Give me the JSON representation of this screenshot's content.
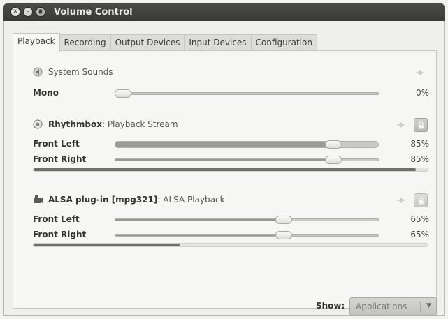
{
  "window": {
    "title": "Volume Control"
  },
  "tabs": [
    "Playback",
    "Recording",
    "Output Devices",
    "Input Devices",
    "Configuration"
  ],
  "streams": [
    {
      "app": "System Sounds",
      "desc": "",
      "channels": [
        {
          "label": "Mono",
          "value": 0,
          "display": "0%"
        }
      ],
      "level": null
    },
    {
      "app": "Rhythmbox",
      "desc": ": Playback Stream",
      "channels": [
        {
          "label": "Front Left",
          "value": 85,
          "display": "85%"
        },
        {
          "label": "Front Right",
          "value": 85,
          "display": "85%"
        }
      ],
      "level": 97
    },
    {
      "app": "ALSA plug-in [mpg321]",
      "desc": ": ALSA Playback",
      "channels": [
        {
          "label": "Front Left",
          "value": 65,
          "display": "65%"
        },
        {
          "label": "Front Right",
          "value": 65,
          "display": "65%"
        }
      ],
      "level": 37
    }
  ],
  "show": {
    "label": "Show:",
    "value": "Applications"
  },
  "icons": {
    "system_sounds": "speaker-icon",
    "rhythmbox": "rhythmbox-icon",
    "alsa": "alsa-plugin-icon",
    "mute": "mute-icon",
    "lock": "lock-icon"
  }
}
